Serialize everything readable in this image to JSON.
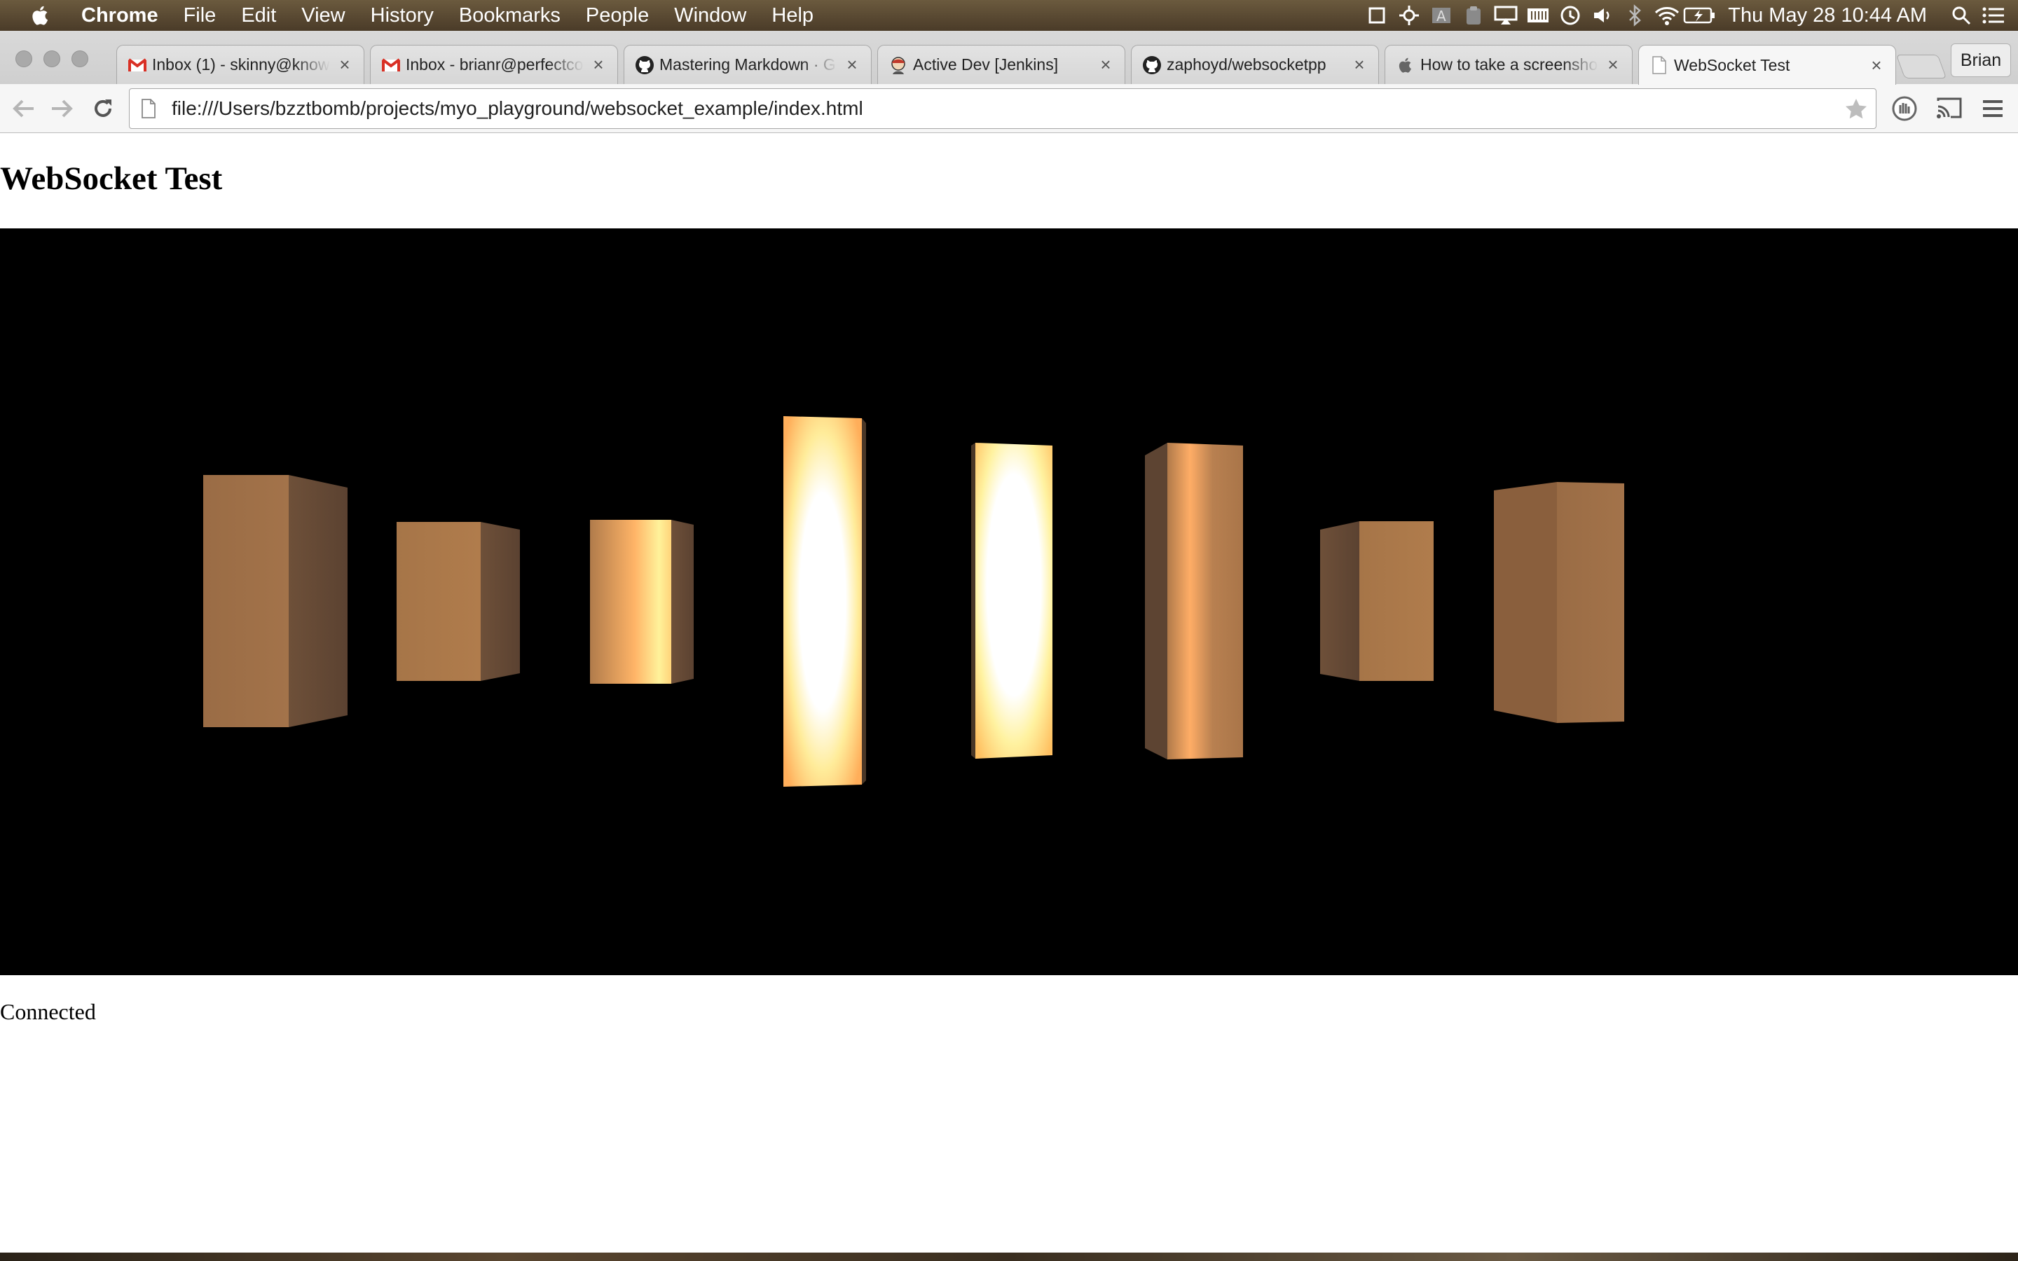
{
  "menubar": {
    "app_name": "Chrome",
    "items": [
      "File",
      "Edit",
      "View",
      "History",
      "Bookmarks",
      "People",
      "Window",
      "Help"
    ],
    "clock": "Thu May 28  10:44 AM",
    "status_icons": [
      "window-icon",
      "move-icon",
      "text-icon",
      "clipboard-icon",
      "airplay-icon",
      "memory-icon",
      "time-machine-icon",
      "volume-icon",
      "bluetooth-icon",
      "wifi-icon",
      "battery-icon",
      "spotlight-icon",
      "notification-center-icon"
    ]
  },
  "tabs": [
    {
      "title": "Inbox (1) - skinny@know",
      "favicon": "gmail-icon",
      "active": false
    },
    {
      "title": "Inbox - brianr@perfectco",
      "favicon": "gmail-icon",
      "active": false
    },
    {
      "title": "Mastering Markdown · G",
      "favicon": "github-icon",
      "active": false
    },
    {
      "title": "Active Dev [Jenkins]",
      "favicon": "jenkins-icon",
      "active": false
    },
    {
      "title": "zaphoyd/websocketpp",
      "favicon": "github-icon",
      "active": false
    },
    {
      "title": "How to take a screensho",
      "favicon": "apple-icon",
      "active": false
    },
    {
      "title": "WebSocket Test",
      "favicon": "page-icon",
      "active": true
    }
  ],
  "profile_name": "Brian",
  "toolbar": {
    "url": "file:///Users/bzztbomb/projects/myo_playground/websocket_example/index.html"
  },
  "page": {
    "heading": "WebSocket Test",
    "status": "Connected"
  },
  "scene": {
    "background": "#000000",
    "box_color": "#b07a4a",
    "highlight_color": "#ffffff",
    "box_count": 8
  }
}
